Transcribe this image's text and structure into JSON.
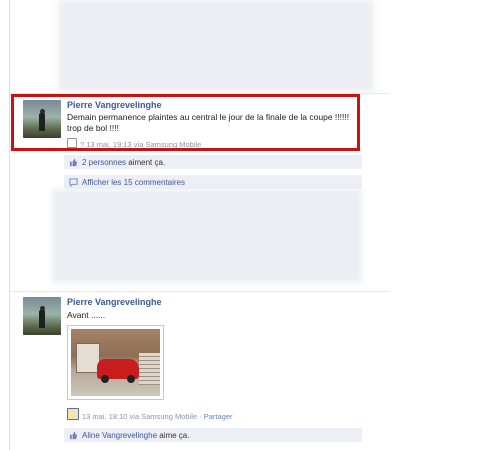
{
  "posts": [
    {
      "author": "Pierre Vangrevelinghe",
      "message": "Demain permanence plaintes au central le jour de la finale de la coupe !!!!!! trop de bol !!!!",
      "meta": "? 13 mai, 19:13 via Samsung Mobile",
      "likes_link": "2 personnes",
      "likes_suffix": " aiment ça.",
      "comments_label": "Afficher les 15 commentaires"
    },
    {
      "author": "Pierre Vangrevelinghe",
      "message": "Avant ......",
      "meta_time": "13 mai, 18:10 via Samsung Mobile · ",
      "meta_share": "Partager",
      "likes_link": "Aline Vangrevelinghe",
      "likes_suffix": " aime ça."
    }
  ],
  "colors": {
    "highlight": "#cc1111",
    "link": "#3b5998"
  }
}
